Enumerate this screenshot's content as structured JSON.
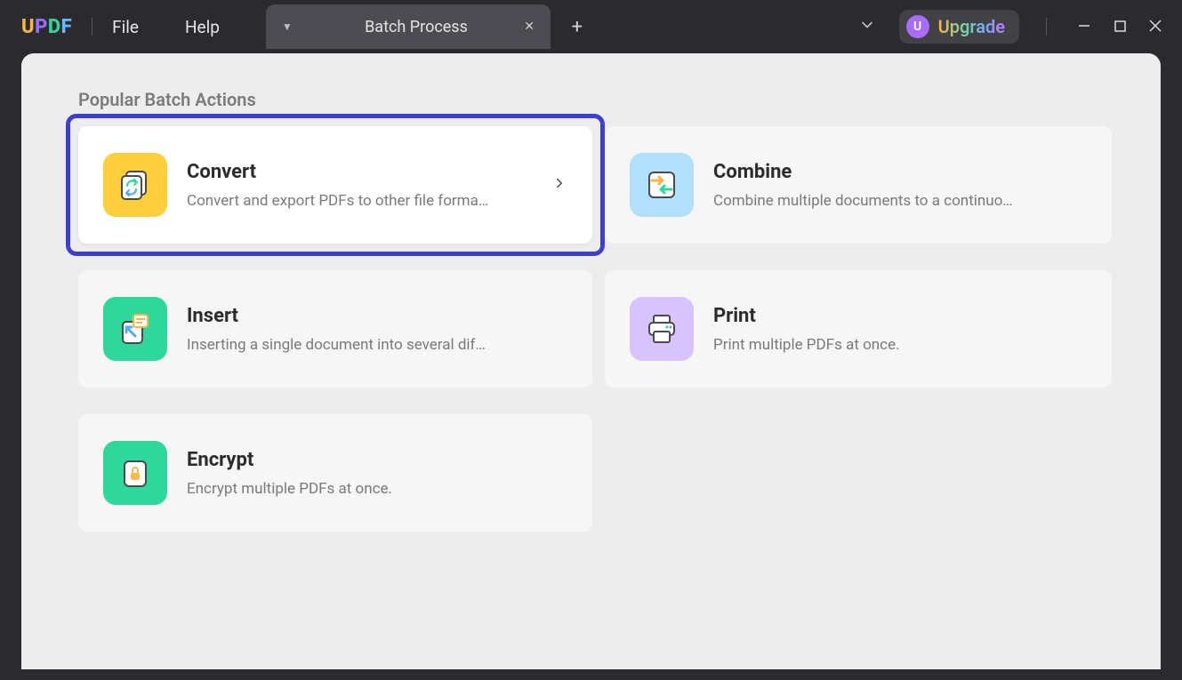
{
  "titlebar": {
    "logo": {
      "U": "U",
      "P": "P",
      "D": "D",
      "F": "F"
    },
    "menu": {
      "file": "File",
      "help": "Help"
    },
    "tab": {
      "title": "Batch Process"
    },
    "upgrade": {
      "avatar": "U",
      "label": "Upgrade"
    }
  },
  "main": {
    "section_title": "Popular Batch Actions",
    "actions": {
      "convert": {
        "title": "Convert",
        "desc": "Convert and export PDFs to other file forma…"
      },
      "combine": {
        "title": "Combine",
        "desc": "Combine multiple documents to a continuo…"
      },
      "insert": {
        "title": "Insert",
        "desc": "Inserting a single document into several dif…"
      },
      "print": {
        "title": "Print",
        "desc": "Print multiple PDFs at once."
      },
      "encrypt": {
        "title": "Encrypt",
        "desc": "Encrypt multiple PDFs at once."
      }
    }
  }
}
